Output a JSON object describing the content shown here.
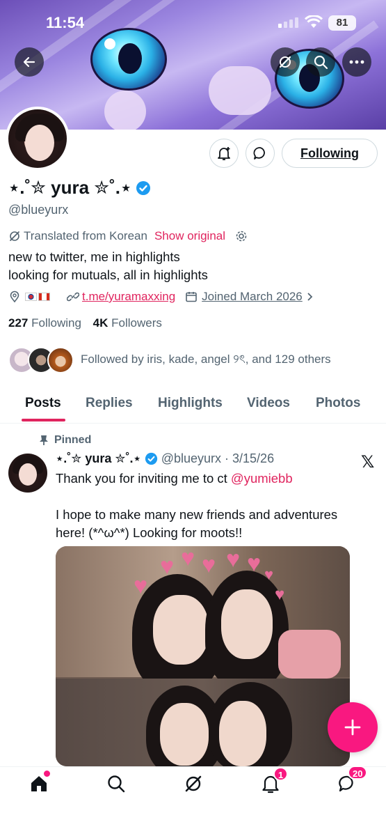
{
  "status_bar": {
    "time": "11:54",
    "battery": "81"
  },
  "profile": {
    "display_name": "⋆.˚✮ yura ✮˚.⋆",
    "handle": "@blueyurx",
    "translated_label": "Translated from Korean",
    "show_original": "Show original",
    "bio_lines": [
      "new to twitter, me in highlights",
      "looking for mutuals, all in highlights"
    ],
    "location_flags": "🇰🇷🇨🇦",
    "link": "t.me/yuramaxxing",
    "joined": "Joined March 2026",
    "following_count": "227",
    "following_label": "Following",
    "followers_count": "4K",
    "followers_label": "Followers",
    "followed_by": "Followed by iris, kade, angel ୨ৎ, and 129 others",
    "following_button": "Following"
  },
  "tabs": [
    "Posts",
    "Replies",
    "Highlights",
    "Videos",
    "Photos"
  ],
  "active_tab": "Posts",
  "pinned_post": {
    "pinned_label": "Pinned",
    "author_name": "⋆.˚✮ yura ✮˚.⋆",
    "author_handle": "@blueyurx",
    "date": "· 3/15/26",
    "text_line1_prefix": "Thank you for inviting me to ct ",
    "mention": "@yumiebb",
    "text_line2": "I hope to make many new friends and adventures here! (*^ω^*) Looking for moots!!"
  },
  "bottom_nav": {
    "notifications_badge": "1",
    "messages_badge": "20"
  },
  "colors": {
    "accent": "#f91880",
    "link": "#e0245e",
    "verified": "#1d9bf0",
    "muted": "#536471"
  }
}
